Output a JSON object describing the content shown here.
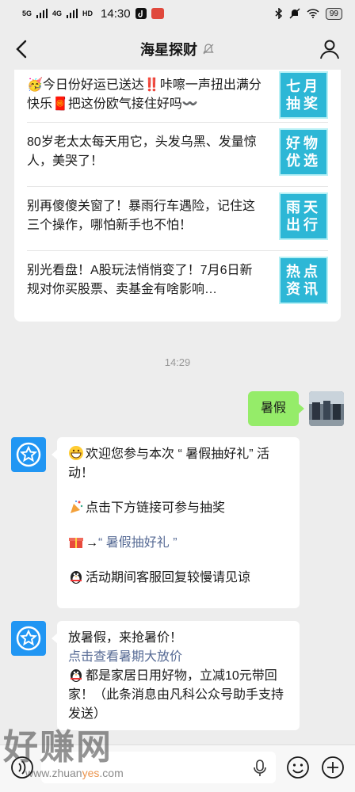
{
  "status_bar": {
    "network1": "5G",
    "network2": "4G",
    "hd": "HD",
    "time": "14:30",
    "battery": "99"
  },
  "header": {
    "title": "海星探财"
  },
  "articles": [
    {
      "text": "🥳今日份好运已送达‼️咔嚓一声扭出满分快乐🧧把这份欧气接住好吗〰️",
      "thumb_line1": "七月",
      "thumb_line2": "抽奖"
    },
    {
      "text": "80岁老太太每天用它，头发乌黑、发量惊人，美哭了！",
      "thumb_line1": "好物",
      "thumb_line2": "优选"
    },
    {
      "text": "别再傻傻关窗了！暴雨行车遇险，记住这三个操作，哪怕新手也不怕！",
      "thumb_line1": "雨天",
      "thumb_line2": "出行"
    },
    {
      "text": "别光看盘！A股玩法悄悄变了！7月6日新规对你买股票、卖基金有啥影响…",
      "thumb_line1": "热点",
      "thumb_line2": "资讯"
    }
  ],
  "chat": {
    "timestamp": "14:29",
    "self_message": "暑假",
    "bot_message1": {
      "line1": "欢迎您参与本次 “ 暑假抽好礼” 活动！",
      "line2": "点击下方链接可参与抽奖",
      "line3_prefix": "→",
      "line3_link": "“ 暑假抽好礼 ”",
      "line4": "活动期间客服回复较慢请见谅"
    },
    "bot_message2": {
      "line1": "放暑假，来抢暑价！",
      "link": "点击查看暑期大放价",
      "line3": "都是家居日用好物，立减10元带回家！（此条消息由凡科公众号助手支持发送）"
    }
  },
  "watermark": {
    "main": "好赚网",
    "sub_prefix": "www.zhuan",
    "sub_highlight": "yes",
    "sub_suffix": ".com"
  },
  "colors": {
    "chat_bg": "#ededed",
    "self_bubble": "#95ec69",
    "link": "#576b95",
    "bot_avatar": "#2196f3",
    "thumb": "#2db7d6"
  }
}
